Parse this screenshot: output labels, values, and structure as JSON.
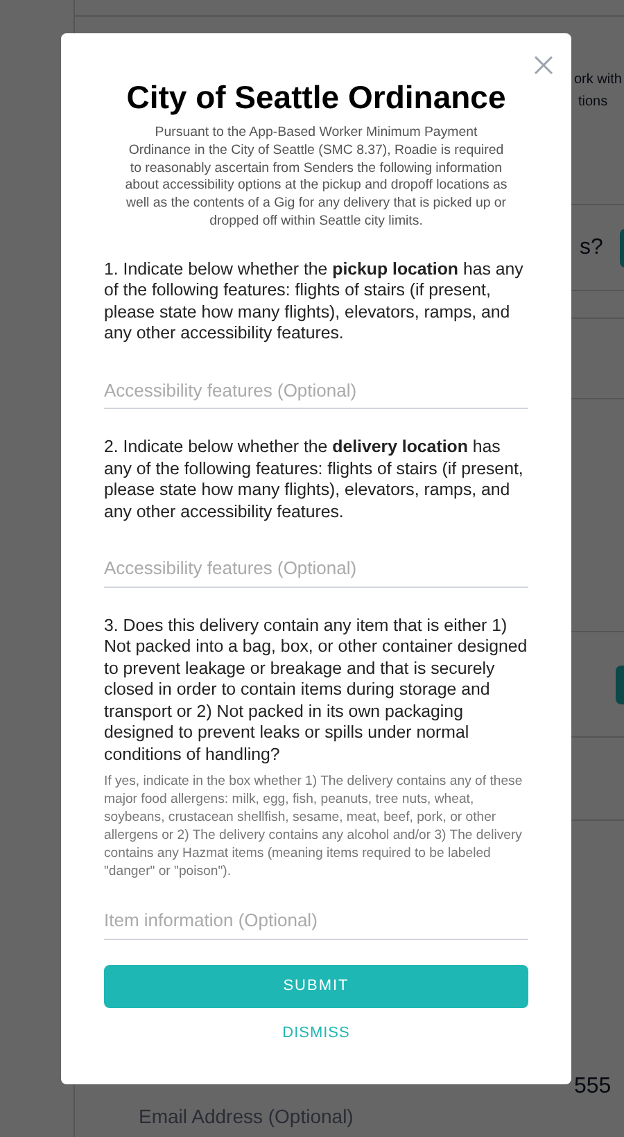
{
  "background": {
    "text_1": "ork with",
    "text_2": "tions",
    "text_3": "s?",
    "text_4": "555",
    "email_placeholder": "Email Address (Optional)"
  },
  "modal": {
    "title": "City of Seattle Ordinance",
    "intro": "Pursuant to the App-Based Worker Minimum Payment Ordinance in the City of Seattle (SMC 8.37), Roadie is required to reasonably ascertain from Senders the following information about accessibility options at the pickup and dropoff locations as well as the contents of a Gig for any delivery that is picked up or dropped off within Seattle city limits.",
    "questions": [
      {
        "text": "1. Indicate below whether the **pickup location** has any of the following features: flights of stairs (if present, please state how many flights), elevators, ramps, and any other accessibility features.",
        "placeholder": "Accessibility features (Optional)"
      },
      {
        "text": "2. Indicate below whether the **delivery location** has any of the following features: flights of stairs (if present, please state how many flights), elevators, ramps, and any other accessibility features.",
        "placeholder": "Accessibility features (Optional)"
      },
      {
        "text": "3. Does this delivery contain any item that is either 1) Not packed into a bag, box, or other container designed to prevent leakage or breakage and that is securely closed in order to contain items during storage and transport or 2) Not packed in its own packaging designed to prevent leaks or spills under normal conditions of handling?",
        "note": "If yes, indicate in the box whether 1) The delivery contains any of these major food allergens: milk, egg, fish, peanuts, tree nuts, wheat, soybeans, crustacean shellfish, sesame, meat, beef, pork, or other allergens or 2) The delivery contains any alcohol and/or 3) The delivery contains any Hazmat items (meaning items required to be labeled \"danger\" or \"poison\").",
        "placeholder": "Item information (Optional)"
      }
    ],
    "submit": "SUBMIT",
    "dismiss": "DISMISS"
  }
}
